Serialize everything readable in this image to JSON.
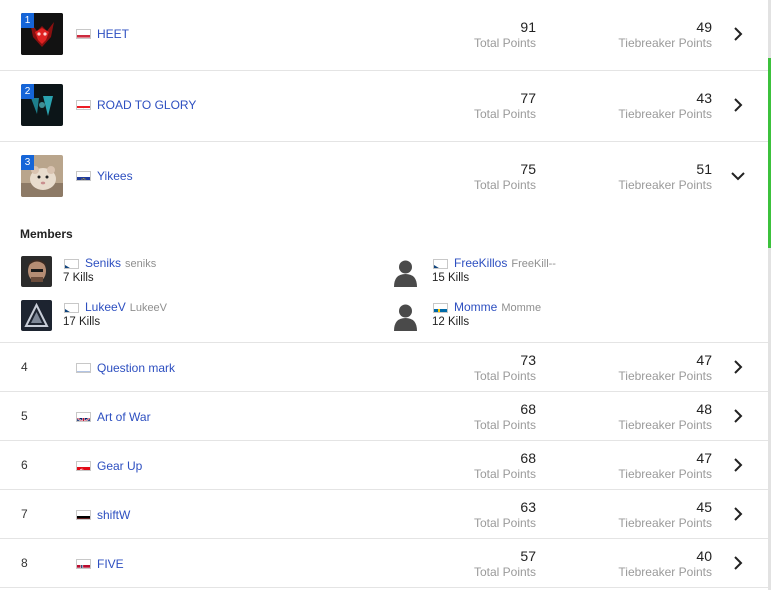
{
  "labels": {
    "total_points": "Total Points",
    "tiebreaker_points": "Tiebreaker Points",
    "members_title": "Members"
  },
  "teams": [
    {
      "rank": "1",
      "name": "HEET",
      "country": "hungary",
      "total": "91",
      "tiebreaker": "49",
      "expanded": false
    },
    {
      "rank": "2",
      "name": "ROAD TO GLORY",
      "country": "lebanon",
      "total": "77",
      "tiebreaker": "43",
      "expanded": false
    },
    {
      "rank": "3",
      "name": "Yikees",
      "country": "europe",
      "total": "75",
      "tiebreaker": "51",
      "expanded": true
    },
    {
      "rank": "4",
      "name": "Question mark",
      "country": "russia",
      "total": "73",
      "tiebreaker": "47",
      "expanded": false
    },
    {
      "rank": "5",
      "name": "Art of War",
      "country": "united-kingdom",
      "total": "68",
      "tiebreaker": "48",
      "expanded": false
    },
    {
      "rank": "6",
      "name": "Gear Up",
      "country": "turkey",
      "total": "68",
      "tiebreaker": "47",
      "expanded": false
    },
    {
      "rank": "7",
      "name": "shiftW",
      "country": "germany",
      "total": "63",
      "tiebreaker": "45",
      "expanded": false
    },
    {
      "rank": "8",
      "name": "FIVE",
      "country": "norway",
      "total": "57",
      "tiebreaker": "40",
      "expanded": false
    }
  ],
  "members": [
    {
      "name": "Seniks",
      "handle": "seniks",
      "country": "czech-republic",
      "kills": "7 Kills",
      "avatar": "photo"
    },
    {
      "name": "FreeKillos",
      "handle": "FreeKill--",
      "country": "czech-republic",
      "kills": "15 Kills",
      "avatar": "default-silhouette"
    },
    {
      "name": "LukeeV",
      "handle": "LukeeV",
      "country": "czech-republic",
      "kills": "17 Kills",
      "avatar": "logo"
    },
    {
      "name": "Momme",
      "handle": "Momme",
      "country": "sweden",
      "kills": "12 Kills",
      "avatar": "default-silhouette"
    }
  ],
  "icons": {
    "row_toggle_collapsed": "chevron-right-icon",
    "row_toggle_expanded": "chevron-down-icon",
    "default_avatar": "user-silhouette-icon"
  },
  "colors": {
    "accent_blue": "#1565d8",
    "link_blue": "#2d4fc0",
    "muted_label": "#9a9a9a",
    "divider": "#e4e4e4",
    "edge_green": "#3cc13c"
  }
}
